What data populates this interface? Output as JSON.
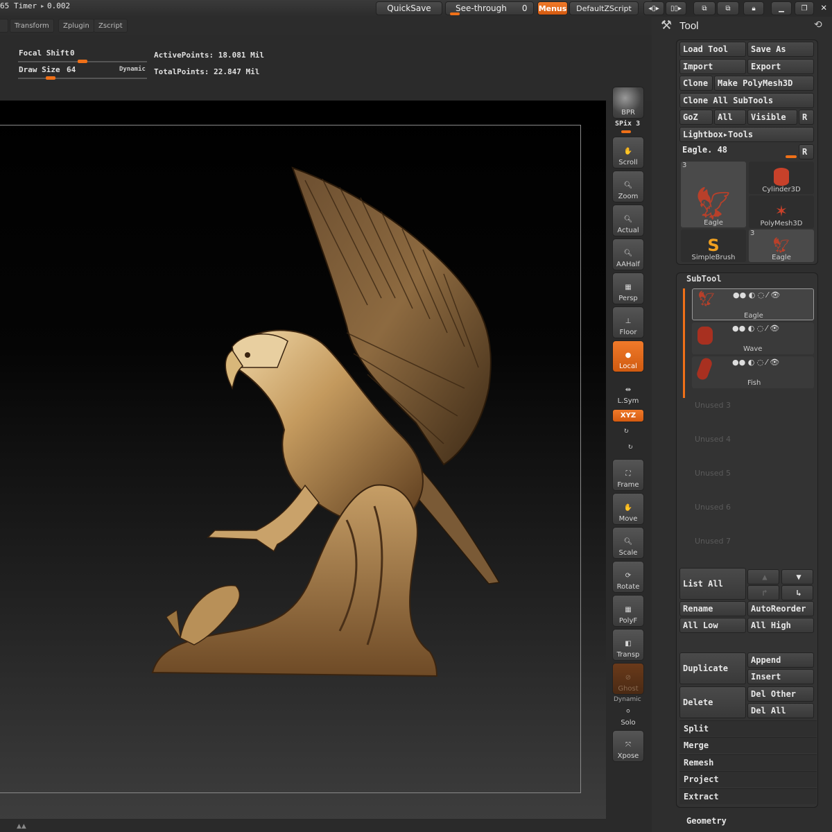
{
  "top_bar": {
    "stat_prefix": "65",
    "timer_label": "Timer",
    "timer_value": "0.002",
    "quicksave": "QuickSave",
    "seethrough_label": "See-through",
    "seethrough_value": "0",
    "menus": "Menus",
    "default_zscript": "DefaultZScript"
  },
  "menu_row": [
    "Transform",
    "Zplugin",
    "Zscript"
  ],
  "info": {
    "focal_shift_label": "Focal Shift",
    "focal_shift_value": "0",
    "draw_size_label": "Draw Size",
    "draw_size_value": "64",
    "dynamic": "Dynamic",
    "active_points": "ActivePoints: 18.081 Mil",
    "total_points": "TotalPoints: 22.847 Mil",
    "focal_shift_fraction": 0.5,
    "draw_size_fraction": 0.25
  },
  "shelf": {
    "bpr": "BPR",
    "spix": "SPix 3",
    "scroll": "Scroll",
    "zoom": "Zoom",
    "actual": "Actual",
    "aahalf": "AAHalf",
    "persp": "Persp",
    "floor": "Floor",
    "local": "Local",
    "lsym": "L.Sym",
    "xyz": "XYZ",
    "frame": "Frame",
    "move": "Move",
    "scale": "Scale",
    "rotate": "Rotate",
    "polyf": "PolyF",
    "transp": "Transp",
    "ghost": "Ghost",
    "dynamic": "Dynamic",
    "solo": "Solo",
    "xpose": "Xpose"
  },
  "tool_panel": {
    "title": "Tool",
    "load_tool": "Load Tool",
    "save_as": "Save As",
    "import": "Import",
    "export": "Export",
    "clone": "Clone",
    "make_polymesh": "Make PolyMesh3D",
    "clone_all": "Clone All SubTools",
    "goz": "GoZ",
    "all": "All",
    "visible": "Visible",
    "r": "R",
    "lightbox_tools": "Lightbox▸Tools",
    "current_tool": "Eagle. 48",
    "thumbs": [
      {
        "label": "Eagle",
        "badge": "3"
      },
      {
        "label": "Cylinder3D",
        "badge": ""
      },
      {
        "label": "PolyMesh3D",
        "badge": ""
      },
      {
        "label": "SimpleBrush",
        "badge": ""
      },
      {
        "label": "Eagle",
        "badge": "3"
      }
    ]
  },
  "subtool": {
    "title": "SubTool",
    "items": [
      {
        "label": "Eagle"
      },
      {
        "label": "Wave"
      },
      {
        "label": "Fish"
      }
    ],
    "unused": [
      "Unused 3",
      "Unused 4",
      "Unused 5",
      "Unused 6",
      "Unused 7"
    ],
    "list_all": "List All",
    "rename": "Rename",
    "autoreorder": "AutoReorder",
    "all_low": "All Low",
    "all_high": "All High",
    "duplicate": "Duplicate",
    "append": "Append",
    "insert": "Insert",
    "delete": "Delete",
    "del_other": "Del Other",
    "del_all": "Del All",
    "split": "Split",
    "merge": "Merge",
    "remesh": "Remesh",
    "project": "Project",
    "extract": "Extract",
    "geometry": "Geometry"
  },
  "colors": {
    "accent": "#ef7018",
    "background": "#2a2a2a",
    "model": "#b8915a"
  }
}
